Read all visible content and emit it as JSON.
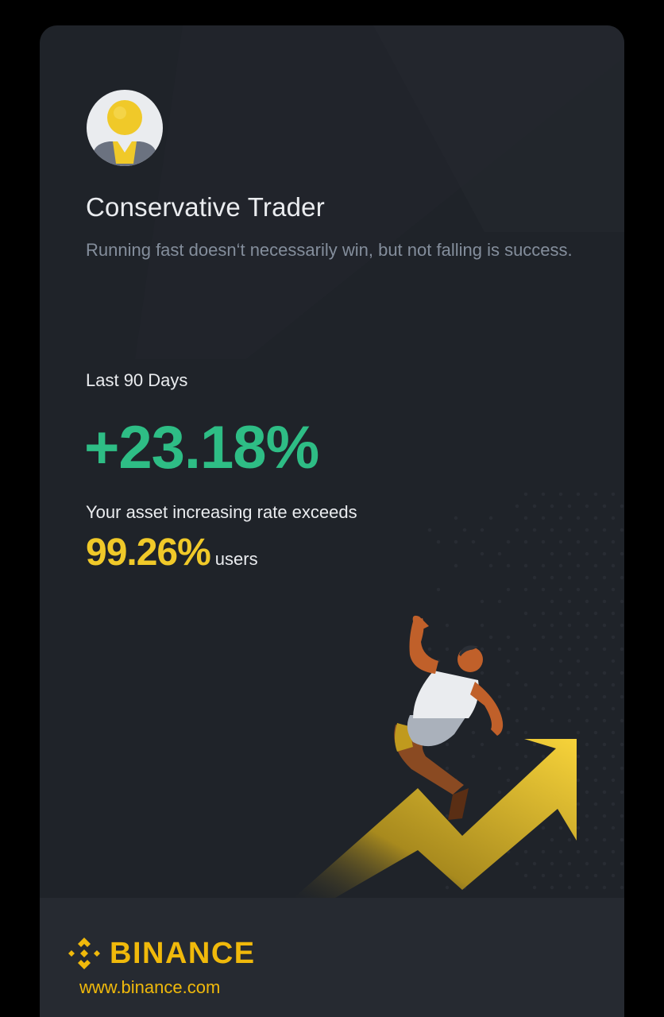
{
  "profile": {
    "title": "Conservative Trader",
    "subtitle": "Running fast doesn‘t necessarily win, but not falling is success."
  },
  "stats": {
    "period_label": "Last 90 Days",
    "pnl_percent": "+23.18%",
    "exceeds_label": "Your asset increasing rate exceeds",
    "rank_value": "99.26%",
    "rank_unit": "users"
  },
  "footer": {
    "brand_name": "BINANCE",
    "url": "www.binance.com"
  },
  "colors": {
    "background": "#000000",
    "card": "#1f2329",
    "footer": "#262a31",
    "positive": "#2ebd85",
    "highlight": "#f0c929",
    "brand": "#f0b90b",
    "muted_text": "#848e9c"
  },
  "icons": {
    "avatar": "trader-avatar-icon",
    "logo": "binance-logo-icon",
    "illustration": "climbing-trader-illustration"
  }
}
